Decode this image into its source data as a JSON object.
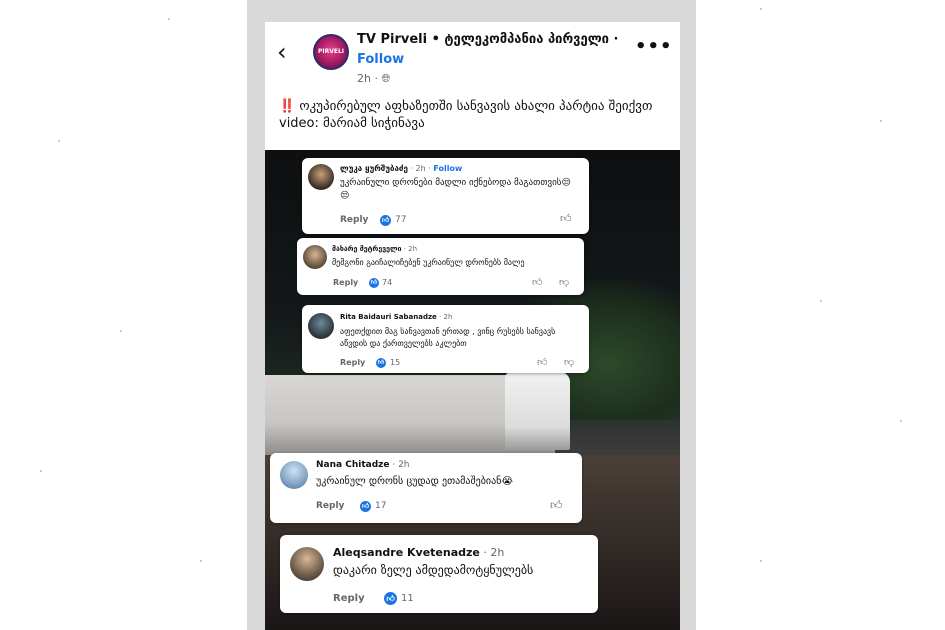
{
  "post": {
    "page_name": "TV Pirveli • ტელეკომპანია პირველი ·",
    "follow": "Follow",
    "time": "2h ·",
    "globe_icon": "globe-icon",
    "more_icon": "more-dots-icon",
    "avatar_text": "PIRVELI",
    "caption_mark": "‼️",
    "caption_line": "ოკუპირებულ აფხაზეთში სანვავის ახალი პარტია შეიქვთ",
    "caption_video": "video: მარიამ სიჭინავა"
  },
  "comments": [
    {
      "name": "ლუკა ყურშუბაძე",
      "time": " · 2h · ",
      "follow": "Follow",
      "text": "უკრაინული დრონები მადლი იქნებოდა მაგათთვის😒😒",
      "reply": "Reply",
      "likes": "77"
    },
    {
      "name": "მახარე მეტრეველი",
      "time": " · 2h",
      "text": "მემგონი გაიჩალიჩებენ უკრაინულ დრონებს მალე",
      "reply": "Reply",
      "likes": "74"
    },
    {
      "name": "Rita Baidauri Sabanadze",
      "time": " · 2h",
      "text": "აფეთქდით მაგ სანვავთან ერთად , ვინც რუსებს სანვავს აწვდის და ქართველებს აკლებთ",
      "reply": "Reply",
      "likes": "15"
    },
    {
      "name": "Nana Chitadze",
      "time": " · 2h",
      "text": "უკრაინულ დრონს ცუდად ეთამაშებიან😭",
      "reply": "Reply",
      "likes": "17"
    },
    {
      "name": "Aleqsandre Kvetenadze",
      "time": " · 2h",
      "text": "დაკარი ზელე ამდედამოტყნულებს",
      "reply": "Reply",
      "likes": "11"
    }
  ],
  "colors": {
    "accent": "#1b74e4",
    "alert": "#d11a2a"
  }
}
